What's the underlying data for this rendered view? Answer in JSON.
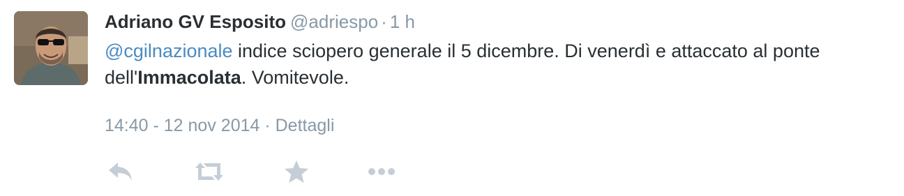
{
  "tweet": {
    "author": {
      "fullname": "Adriano GV Esposito",
      "username": "@adriespo"
    },
    "header_separator": "·",
    "relative_time": "1 h",
    "text": {
      "mention": "@cgilnazionale",
      "part1": " indice sciopero generale il 5 dicembre. Di venerdì e attaccato al ponte dell'",
      "bold": "Immacolata",
      "part2": ". Vomitevole."
    },
    "timestamp": "14:40 - 12 nov 2014",
    "meta_separator": " · ",
    "details_label": "Dettagli",
    "actions": {
      "reply": "reply-icon",
      "retweet": "retweet-icon",
      "favorite": "star-icon",
      "more": "more-icon"
    }
  },
  "colors": {
    "text": "#292f33",
    "muted": "#8899a6",
    "link": "#4a8bc1",
    "icon": "#c5ced6"
  }
}
